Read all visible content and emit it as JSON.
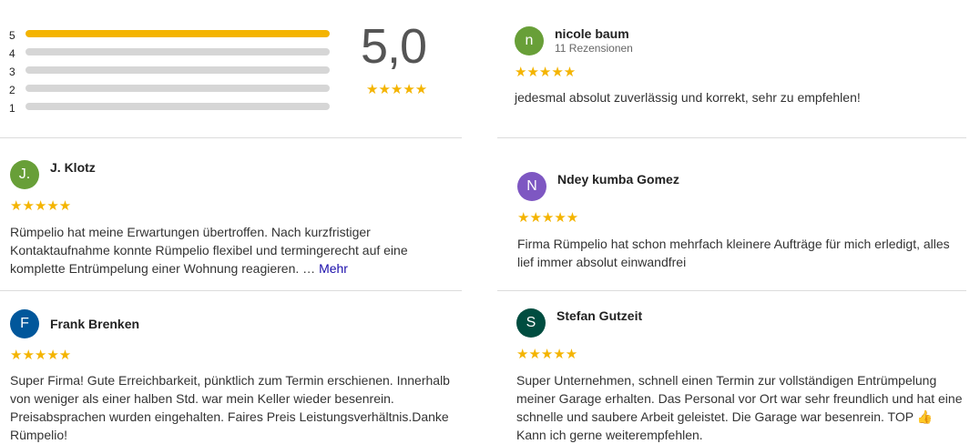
{
  "summary": {
    "score": "5,0",
    "stars": "★★★★★",
    "bars": [
      {
        "label": "5",
        "fill": 1.0
      },
      {
        "label": "4",
        "fill": 0.0
      },
      {
        "label": "3",
        "fill": 0.0
      },
      {
        "label": "2",
        "fill": 0.0
      },
      {
        "label": "1",
        "fill": 0.0
      }
    ]
  },
  "colors": {
    "star": "#f4b400",
    "avatar_green": "#689f38",
    "avatar_purple": "#7e57c2",
    "avatar_blue": "#01579b",
    "avatar_darkgreen": "#004d40",
    "link": "#1a0dab"
  },
  "reviews": [
    {
      "initial": "n",
      "name": "nicole baum",
      "subtitle": "11 Rezensionen",
      "stars": "★★★★★",
      "text": "jedesmal absolut zuverlässig und korrekt, sehr zu empfehlen!"
    },
    {
      "initial": "J.",
      "name": "J. Klotz",
      "stars": "★★★★★",
      "text": "Rümpelio hat meine Erwartungen übertroffen. Nach kurzfristiger Kontaktaufnahme konnte Rümpelio flexibel und termingerecht auf eine komplette Entrümpelung einer Wohnung reagieren. …",
      "more": "Mehr"
    },
    {
      "initial": "N",
      "name": "Ndey kumba Gomez",
      "stars": "★★★★★",
      "text": "Firma Rümpelio hat schon mehrfach kleinere Aufträge für mich erledigt, alles lief immer absolut einwandfrei"
    },
    {
      "initial": "F",
      "name": "Frank Brenken",
      "stars": "★★★★★",
      "text": "Super Firma! Gute Erreichbarkeit, pünktlich zum Termin erschienen. Innerhalb von weniger als einer halben Std. war mein Keller wieder besenrein. Preisabsprachen wurden eingehalten. Faires Preis Leistungsverhältnis.Danke Rümpelio!"
    },
    {
      "initial": "S",
      "name": "Stefan Gutzeit",
      "stars": "★★★★★",
      "text": "Super Unternehmen, schnell einen Termin zur vollständigen Entrümpelung meiner Garage erhalten. Das Personal vor Ort war sehr freundlich und hat eine schnelle und saubere Arbeit geleistet. Die Garage war besenrein. TOP 👍 Kann ich gerne weiterempfehlen."
    }
  ]
}
